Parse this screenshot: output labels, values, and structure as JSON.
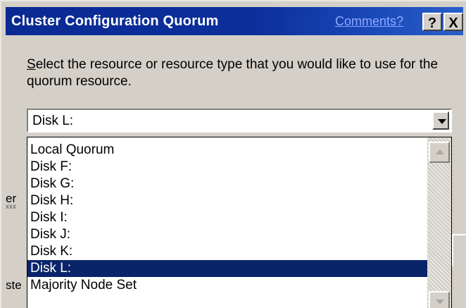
{
  "dialog": {
    "title": "Cluster Configuration Quorum",
    "comments_link": "Comments?",
    "help_button": "?",
    "close_button": "X"
  },
  "prompt": {
    "accelerator": "S",
    "text_rest": "elect the resource or resource type that you would like to use for the quorum resource."
  },
  "combo": {
    "selected_value": "Disk L:"
  },
  "dropdown": {
    "items": [
      "Local Quorum",
      "Disk F:",
      "Disk G:",
      "Disk H:",
      "Disk I:",
      "Disk J:",
      "Disk K:",
      "Disk L:",
      "Majority Node Set"
    ],
    "selected_index": 7
  },
  "background_fragments": {
    "left_fragment_1": "er",
    "left_fragment_2": "xxx",
    "left_fragment_3": "ste"
  },
  "colors": {
    "titlebar": "#0a2a93",
    "selection": "#0a246a",
    "dialog_face": "#d4d0c8",
    "comments_link": "#8fa9ff"
  }
}
